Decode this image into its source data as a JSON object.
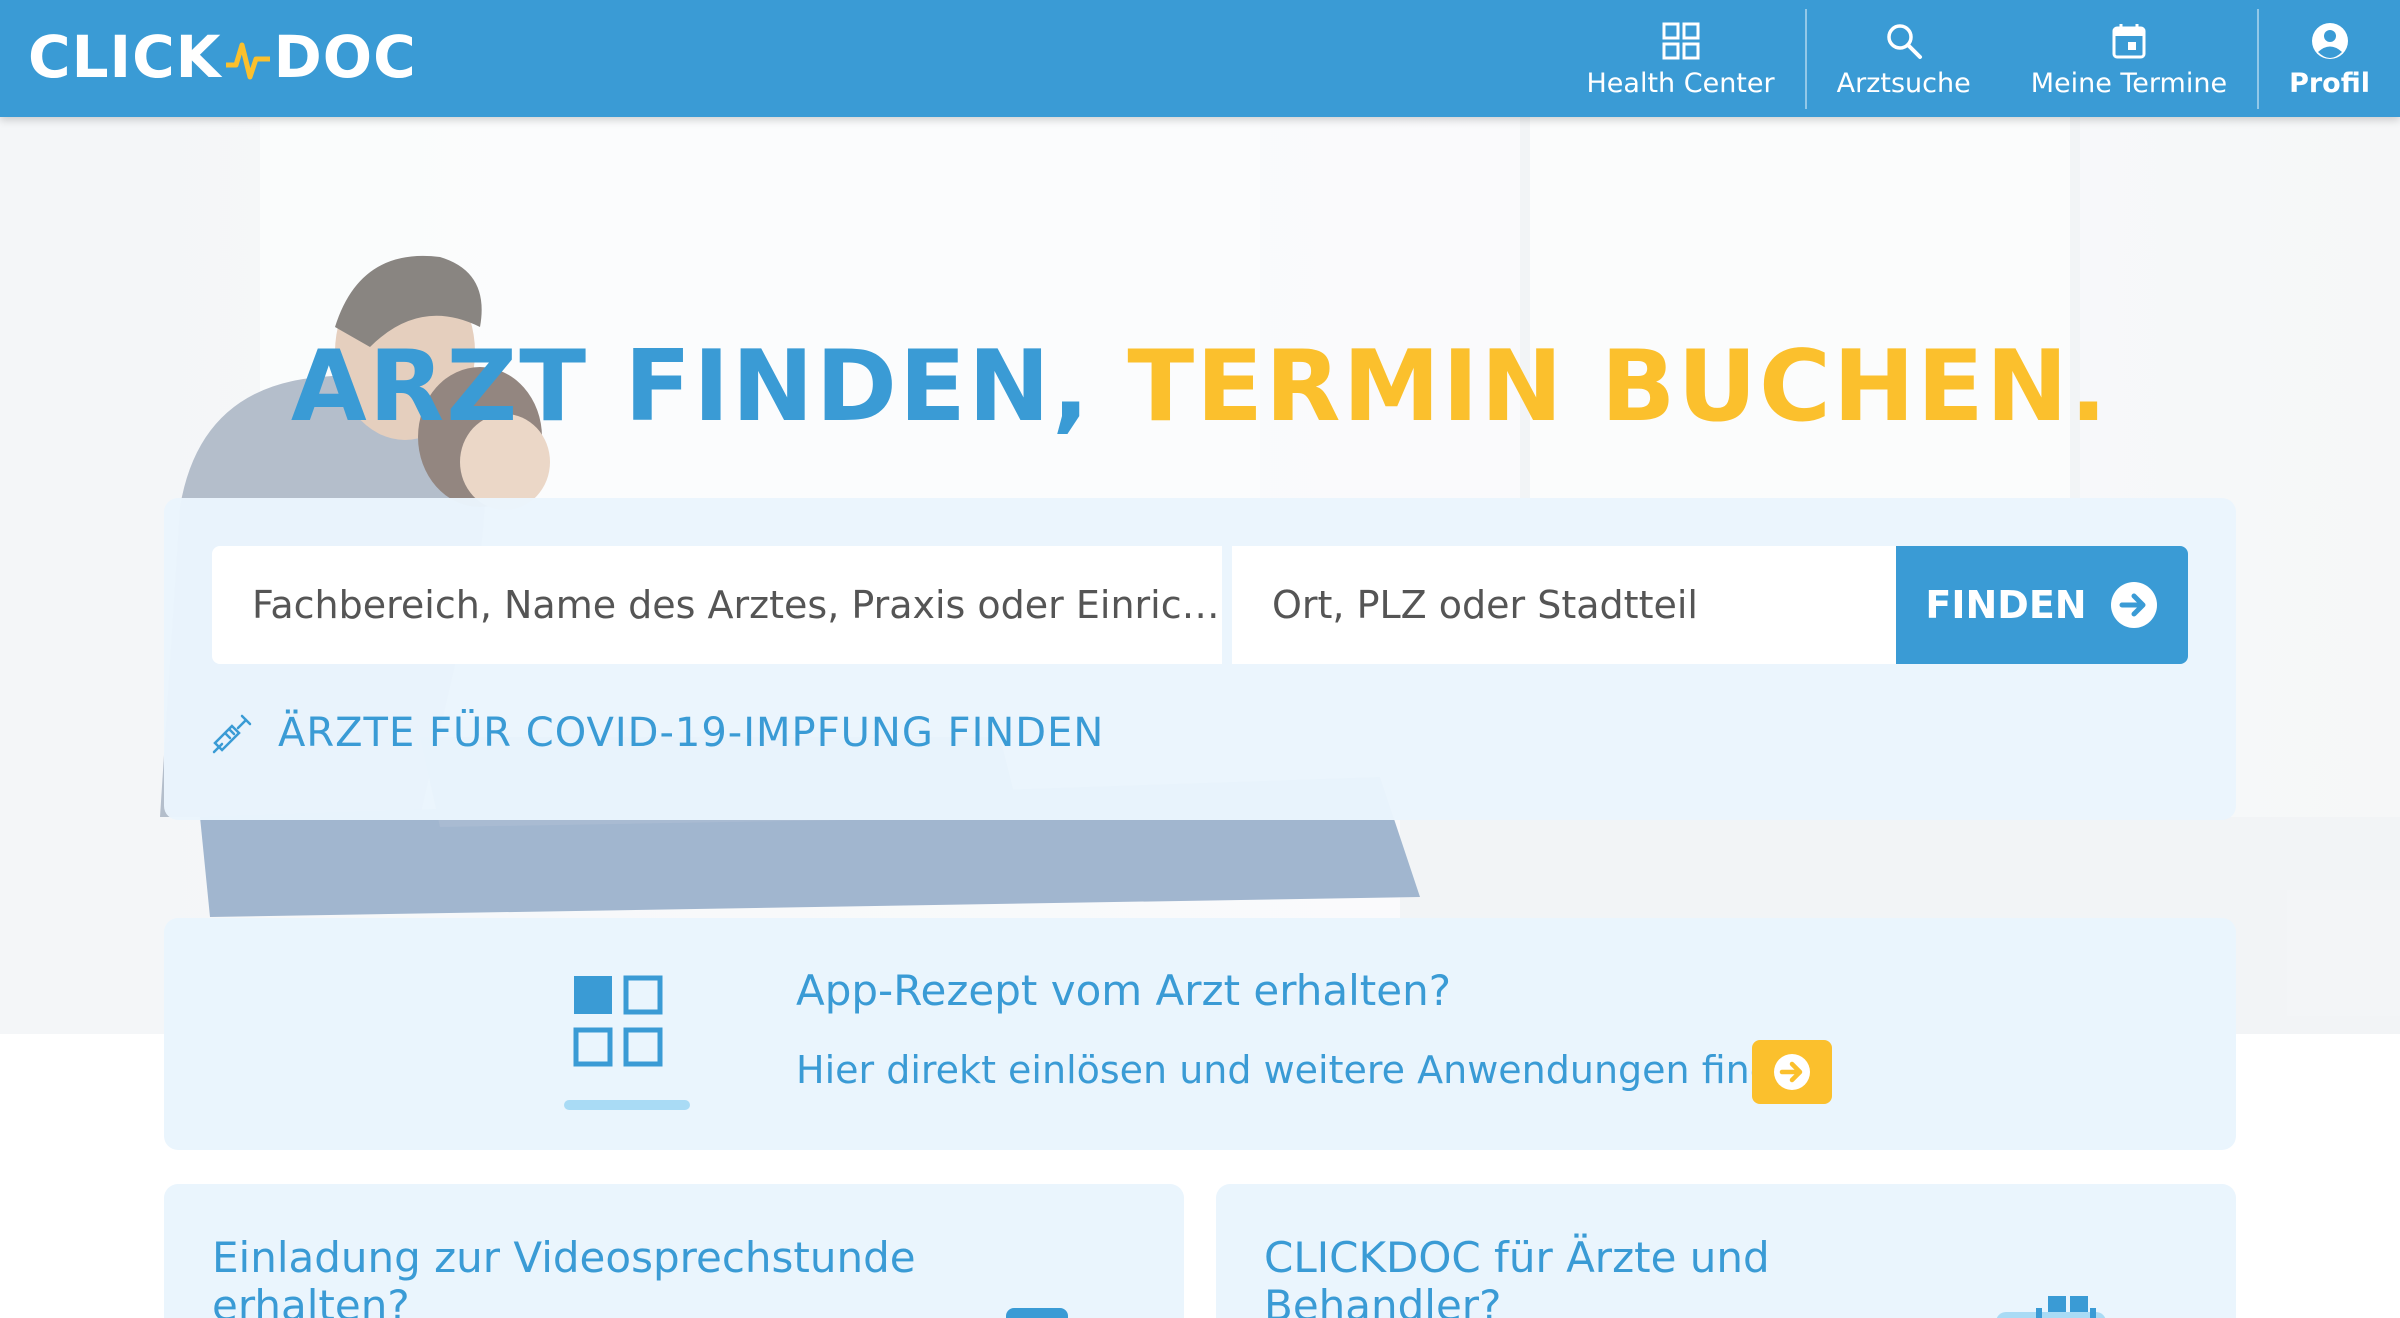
{
  "header": {
    "logo_left": "CLICK",
    "logo_right": "DOC",
    "nav": [
      {
        "label": "Health Center",
        "icon": "grid-icon"
      },
      {
        "label": "Arztsuche",
        "icon": "search-icon"
      },
      {
        "label": "Meine Termine",
        "icon": "calendar-icon"
      },
      {
        "label": "Profil",
        "icon": "profile-icon"
      }
    ]
  },
  "hero": {
    "headline_blue": "ARZT FINDEN",
    "headline_comma": ",",
    "headline_yellow": "TERMIN BUCHEN."
  },
  "search": {
    "specialty_placeholder": "Fachbereich, Name des Arztes, Praxis oder Einric…",
    "location_placeholder": "Ort, PLZ oder Stadtteil",
    "find_label": "FINDEN",
    "covid_link": "ÄRZTE FÜR COVID-19-IMPFUNG FINDEN"
  },
  "app_card": {
    "title": "App-Rezept vom Arzt erhalten?",
    "subtitle": "Hier direkt einlösen und weitere Anwendungen finden"
  },
  "bottom_cards": [
    {
      "title": "Einladung zur Videosprechstunde erhalten?"
    },
    {
      "title": "CLICKDOC für Ärzte und Behandler?"
    }
  ],
  "colors": {
    "brand_blue": "#3a9bd5",
    "brand_yellow": "#fbc02d",
    "card_bg": "#eaf5fd"
  }
}
